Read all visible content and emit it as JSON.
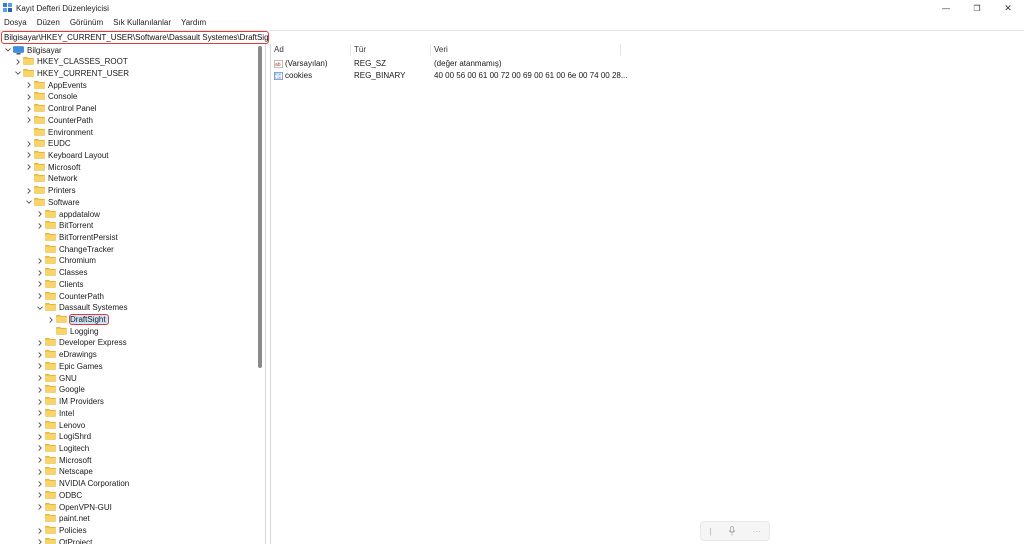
{
  "window": {
    "title": "Kayıt Defteri Düzenleyicisi",
    "minimize": "—",
    "maximize": "❐",
    "close": "✕"
  },
  "menu": [
    {
      "label": "Dosya"
    },
    {
      "label": "Düzen"
    },
    {
      "label": "Görünüm"
    },
    {
      "label": "Sık Kullanılanlar"
    },
    {
      "label": "Yardım"
    }
  ],
  "address": {
    "value": "Bilgisayar\\HKEY_CURRENT_USER\\Software\\Dassault Systemes\\DraftSight"
  },
  "tree": {
    "root": "Bilgisayar",
    "items": [
      {
        "label": "HKEY_CLASSES_ROOT",
        "level": 1,
        "chevron": "right"
      },
      {
        "label": "HKEY_CURRENT_USER",
        "level": 1,
        "chevron": "down"
      },
      {
        "label": "AppEvents",
        "level": 2,
        "chevron": "right"
      },
      {
        "label": "Console",
        "level": 2,
        "chevron": "right"
      },
      {
        "label": "Control Panel",
        "level": 2,
        "chevron": "right"
      },
      {
        "label": "CounterPath",
        "level": 2,
        "chevron": "right"
      },
      {
        "label": "Environment",
        "level": 2,
        "chevron": "none"
      },
      {
        "label": "EUDC",
        "level": 2,
        "chevron": "right"
      },
      {
        "label": "Keyboard Layout",
        "level": 2,
        "chevron": "right"
      },
      {
        "label": "Microsoft",
        "level": 2,
        "chevron": "right"
      },
      {
        "label": "Network",
        "level": 2,
        "chevron": "none"
      },
      {
        "label": "Printers",
        "level": 2,
        "chevron": "right"
      },
      {
        "label": "Software",
        "level": 2,
        "chevron": "down"
      },
      {
        "label": "appdatalow",
        "level": 3,
        "chevron": "right"
      },
      {
        "label": "BitTorrent",
        "level": 3,
        "chevron": "right"
      },
      {
        "label": "BitTorrentPersist",
        "level": 3,
        "chevron": "none"
      },
      {
        "label": "ChangeTracker",
        "level": 3,
        "chevron": "none"
      },
      {
        "label": "Chromium",
        "level": 3,
        "chevron": "right"
      },
      {
        "label": "Classes",
        "level": 3,
        "chevron": "right"
      },
      {
        "label": "Clients",
        "level": 3,
        "chevron": "right"
      },
      {
        "label": "CounterPath",
        "level": 3,
        "chevron": "right"
      },
      {
        "label": "Dassault Systemes",
        "level": 3,
        "chevron": "down"
      },
      {
        "label": "DraftSight",
        "level": 4,
        "chevron": "right",
        "selected": true
      },
      {
        "label": "Logging",
        "level": 4,
        "chevron": "none"
      },
      {
        "label": "Developer Express",
        "level": 3,
        "chevron": "right"
      },
      {
        "label": "eDrawings",
        "level": 3,
        "chevron": "right"
      },
      {
        "label": "Epic Games",
        "level": 3,
        "chevron": "right"
      },
      {
        "label": "GNU",
        "level": 3,
        "chevron": "right"
      },
      {
        "label": "Google",
        "level": 3,
        "chevron": "right"
      },
      {
        "label": "IM Providers",
        "level": 3,
        "chevron": "right"
      },
      {
        "label": "Intel",
        "level": 3,
        "chevron": "right"
      },
      {
        "label": "Lenovo",
        "level": 3,
        "chevron": "right"
      },
      {
        "label": "LogiShrd",
        "level": 3,
        "chevron": "right"
      },
      {
        "label": "Logitech",
        "level": 3,
        "chevron": "right"
      },
      {
        "label": "Microsoft",
        "level": 3,
        "chevron": "right"
      },
      {
        "label": "Netscape",
        "level": 3,
        "chevron": "right"
      },
      {
        "label": "NVIDIA Corporation",
        "level": 3,
        "chevron": "right"
      },
      {
        "label": "ODBC",
        "level": 3,
        "chevron": "right"
      },
      {
        "label": "OpenVPN-GUI",
        "level": 3,
        "chevron": "right"
      },
      {
        "label": "paint.net",
        "level": 3,
        "chevron": "none"
      },
      {
        "label": "Policies",
        "level": 3,
        "chevron": "right"
      },
      {
        "label": "QtProject",
        "level": 3,
        "chevron": "right"
      }
    ]
  },
  "list": {
    "columns": [
      "Ad",
      "Tür",
      "Veri"
    ],
    "rows": [
      {
        "name": "(Varsayılan)",
        "type": "REG_SZ",
        "data": "(değer atanmamış)",
        "icon": "string-value-icon"
      },
      {
        "name": "cookies",
        "type": "REG_BINARY",
        "data": "40 00 56 00 61 00 72 00 69 00 61 00 6e 00 74 00 28...",
        "icon": "binary-value-icon"
      }
    ]
  },
  "mini_toolbar": {
    "separator": "|",
    "more": "···"
  },
  "colors": {
    "highlight": "#e23b3b",
    "selection": "#cce4f7",
    "folder": "#f5c542"
  }
}
